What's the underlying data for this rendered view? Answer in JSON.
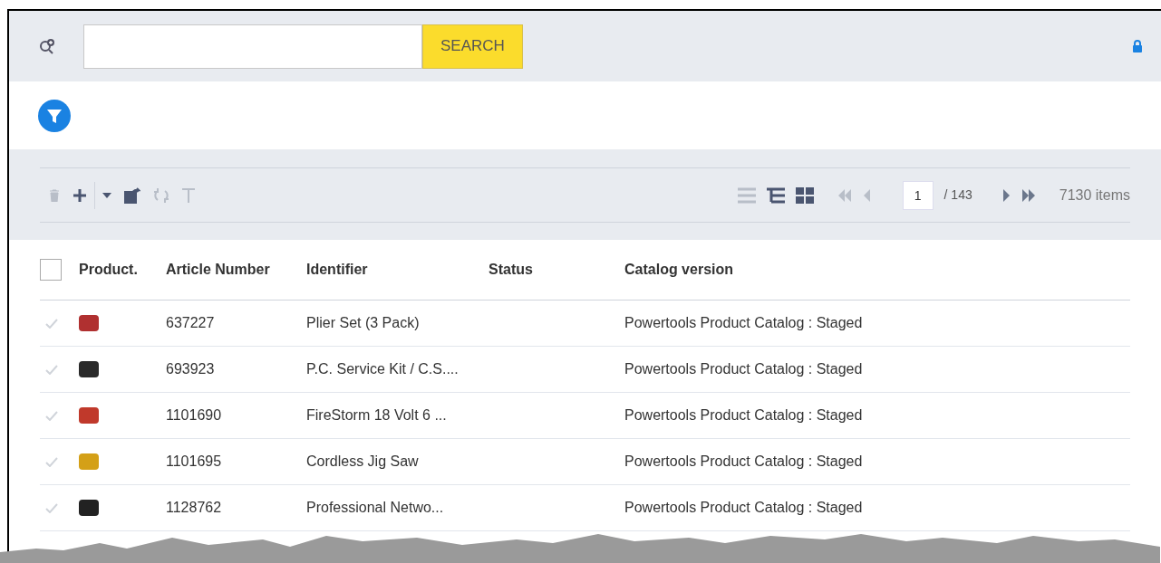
{
  "search": {
    "button": "SEARCH"
  },
  "toolbar": {
    "page": "1",
    "page_total": "/ 143",
    "item_count": "7130 items"
  },
  "table": {
    "select_all_checked": false,
    "columns": [
      "Product.",
      "Article Number",
      "Identifier",
      "Status",
      "Catalog version"
    ],
    "rows": [
      {
        "checked": false,
        "article": "637227",
        "identifier": "Plier Set (3 Pack)",
        "catalog": "Powertools Product Catalog : Staged"
      },
      {
        "checked": false,
        "article": "693923",
        "identifier": "P.C. Service Kit / C.S....",
        "catalog": "Powertools Product Catalog : Staged"
      },
      {
        "checked": false,
        "article": "1101690",
        "identifier": "FireStorm 18 Volt 6 ...",
        "catalog": "Powertools Product Catalog : Staged"
      },
      {
        "checked": false,
        "article": "1101695",
        "identifier": "Cordless Jig Saw",
        "catalog": "Powertools Product Catalog : Staged"
      },
      {
        "checked": false,
        "article": "1128762",
        "identifier": "Professional Netwo...",
        "catalog": "Powertools Product Catalog : Staged"
      }
    ]
  }
}
